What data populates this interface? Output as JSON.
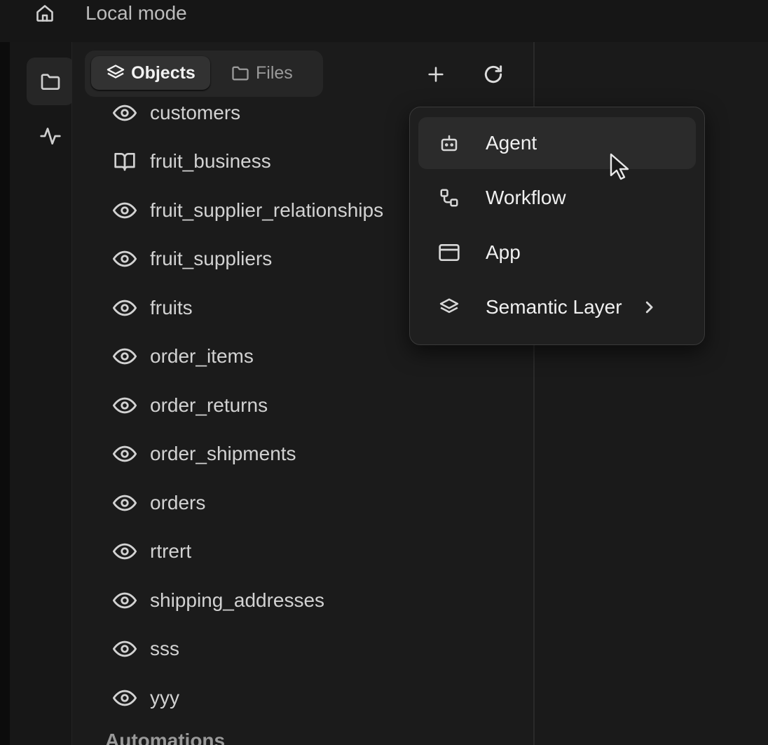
{
  "header": {
    "mode_label": "Local mode"
  },
  "rail": {
    "items": [
      {
        "icon": "folder-icon"
      },
      {
        "icon": "activity-icon"
      }
    ]
  },
  "explorer": {
    "tabs": [
      {
        "label": "Objects",
        "icon": "layers-icon"
      },
      {
        "label": "Files",
        "icon": "folder-icon"
      }
    ],
    "items": [
      {
        "label": "customers",
        "icon": "eye-icon"
      },
      {
        "label": "fruit_business",
        "icon": "book-open-icon"
      },
      {
        "label": "fruit_supplier_relationships",
        "icon": "eye-icon"
      },
      {
        "label": "fruit_suppliers",
        "icon": "eye-icon"
      },
      {
        "label": "fruits",
        "icon": "eye-icon"
      },
      {
        "label": "order_items",
        "icon": "eye-icon"
      },
      {
        "label": "order_returns",
        "icon": "eye-icon"
      },
      {
        "label": "order_shipments",
        "icon": "eye-icon"
      },
      {
        "label": "orders",
        "icon": "eye-icon"
      },
      {
        "label": "rtrert",
        "icon": "eye-icon"
      },
      {
        "label": "shipping_addresses",
        "icon": "eye-icon"
      },
      {
        "label": "sss",
        "icon": "eye-icon"
      },
      {
        "label": "yyy",
        "icon": "eye-icon"
      }
    ],
    "next_section": "Automations"
  },
  "new_menu": {
    "items": [
      {
        "label": "Agent",
        "icon": "bot-icon"
      },
      {
        "label": "Workflow",
        "icon": "workflow-icon"
      },
      {
        "label": "App",
        "icon": "app-window-icon"
      },
      {
        "label": "Semantic Layer",
        "icon": "layers-icon",
        "submenu": true
      }
    ]
  }
}
